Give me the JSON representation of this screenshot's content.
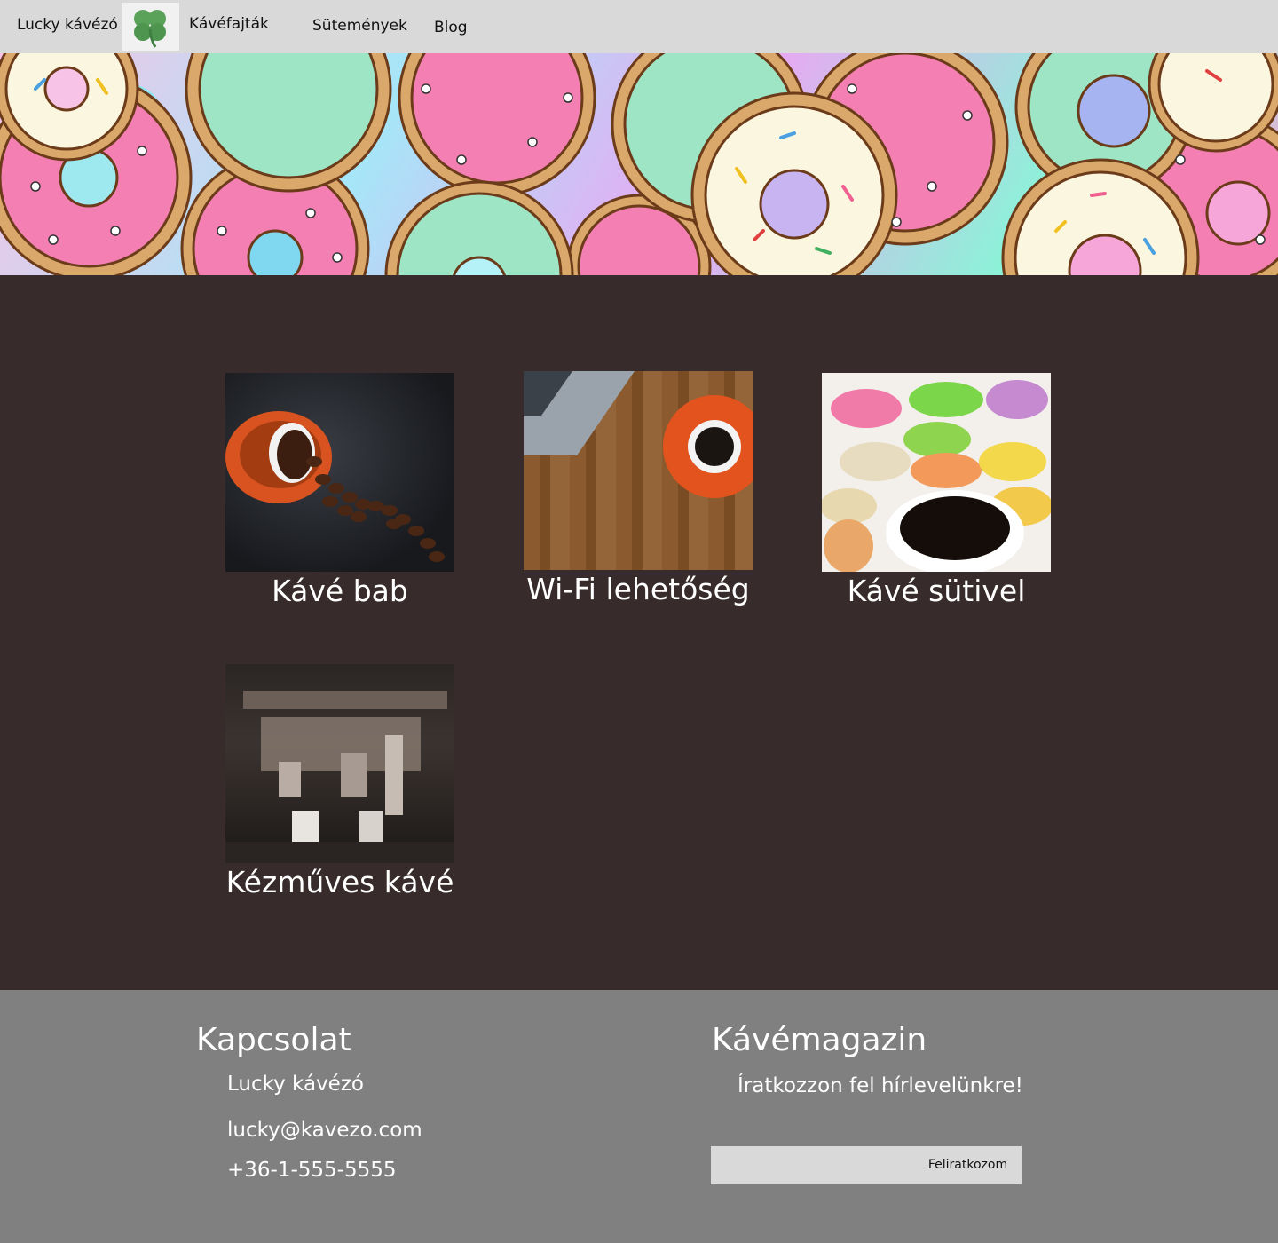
{
  "nav": {
    "brand": "Lucky kávézó",
    "links": [
      "Kávéfajták",
      "Sütemények",
      "Blog"
    ]
  },
  "cards": [
    {
      "title": "Kávé bab"
    },
    {
      "title": "Wi-Fi lehetőség"
    },
    {
      "title": "Kávé sütivel"
    },
    {
      "title": "Kézműves kávé"
    }
  ],
  "footer": {
    "contact_title": "Kapcsolat",
    "contact_lines": [
      "Lucky kávézó",
      "lucky@kavezo.com",
      "+36-1-555-5555"
    ],
    "magazine_title": "Kávémagazin",
    "newsletter_text": "Íratkozzon fel hírlevelünkre!",
    "subscribe_label": "Feliratkozom"
  },
  "colors": {
    "nav_bg": "#d9d9d9",
    "main_bg": "#372b2b",
    "footer_bg": "#808080"
  }
}
